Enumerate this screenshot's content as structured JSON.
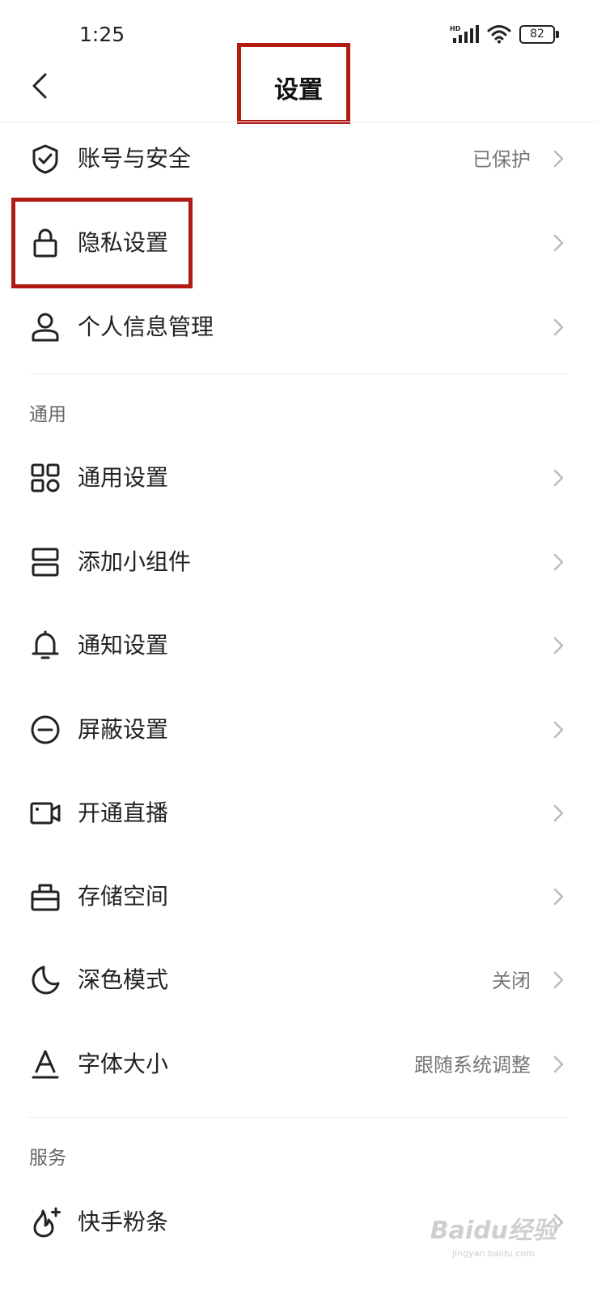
{
  "status_bar": {
    "time": "1:25",
    "battery": "82",
    "network_badge": "HD"
  },
  "header": {
    "title": "设置",
    "back_icon": "chevron-left-icon"
  },
  "items": [
    {
      "label": "账号与安全",
      "value": "已保护",
      "icon": "shield-check-icon"
    },
    {
      "label": "隐私设置",
      "value": "",
      "icon": "lock-icon"
    },
    {
      "label": "个人信息管理",
      "value": "",
      "icon": "person-icon"
    }
  ],
  "general": {
    "title": "通用",
    "items": [
      {
        "label": "通用设置",
        "value": "",
        "icon": "grid-icon"
      },
      {
        "label": "添加小组件",
        "value": "",
        "icon": "widget-icon"
      },
      {
        "label": "通知设置",
        "value": "",
        "icon": "bell-icon"
      },
      {
        "label": "屏蔽设置",
        "value": "",
        "icon": "block-icon"
      },
      {
        "label": "开通直播",
        "value": "",
        "icon": "video-camera-icon"
      },
      {
        "label": "存储空间",
        "value": "",
        "icon": "storage-icon"
      },
      {
        "label": "深色模式",
        "value": "关闭",
        "icon": "moon-icon"
      },
      {
        "label": "字体大小",
        "value": "跟随系统调整",
        "icon": "font-size-icon"
      }
    ]
  },
  "services": {
    "title": "服务",
    "items": [
      {
        "label": "快手粉条",
        "value": "",
        "icon": "flame-plus-icon"
      }
    ]
  },
  "watermark": {
    "logo": "Baidu经验",
    "url": "jingyan.baidu.com"
  },
  "colors": {
    "highlight_box": "#b21a14",
    "text": "#222222",
    "secondary_text": "#777777"
  }
}
